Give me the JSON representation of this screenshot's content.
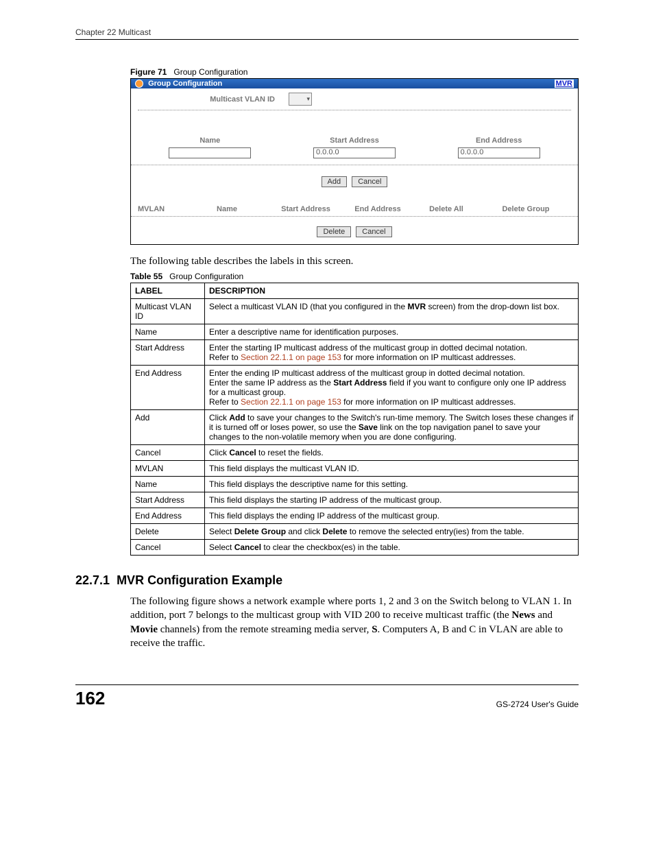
{
  "header": {
    "chapter": "Chapter 22 Multicast"
  },
  "figure": {
    "caption_label": "Figure 71",
    "caption_text": "Group Configuration",
    "title": "Group Configuration",
    "mvr_link": "MVR",
    "multicast_vlan_id_label": "Multicast VLAN ID",
    "cols": {
      "name": "Name",
      "start": "Start Address",
      "end": "End Address"
    },
    "inputs": {
      "name": "",
      "start": "0.0.0.0",
      "end": "0.0.0.0"
    },
    "add_btn": "Add",
    "cancel_btn": "Cancel",
    "table_head": {
      "mvlan": "MVLAN",
      "name": "Name",
      "start": "Start Address",
      "end": "End Address",
      "delete_all": "Delete All",
      "delete_group": "Delete Group"
    },
    "delete_btn": "Delete",
    "cancel2_btn": "Cancel"
  },
  "intro_text": "The following table describes the labels in this screen.",
  "table": {
    "caption_label": "Table 55",
    "caption_text": "Group Configuration",
    "head": {
      "label": "LABEL",
      "description": "DESCRIPTION"
    },
    "rows": [
      {
        "label": "Multicast VLAN ID",
        "desc_pre": "Select a multicast VLAN ID (that you configured in the ",
        "desc_bold": "MVR",
        "desc_post": " screen) from the drop-down list box."
      },
      {
        "label": "Name",
        "desc": "Enter a descriptive name for identification purposes."
      },
      {
        "label": "Start Address",
        "desc_line1": "Enter the starting IP multicast address of the multicast group in dotted decimal notation.",
        "desc_refer": "Refer to ",
        "desc_xref": "Section 22.1.1 on page 153",
        "desc_after": " for more information on IP multicast addresses."
      },
      {
        "label": "End Address",
        "l1": "Enter the ending IP multicast address of the multicast group in dotted decimal notation.",
        "l2_pre": "Enter the same IP address as the ",
        "l2_bold": "Start Address",
        "l2_post": " field if you want to configure only one IP address for a multicast group.",
        "l3_refer": "Refer to ",
        "l3_xref": "Section 22.1.1 on page 153",
        "l3_after": " for more information on IP multicast addresses."
      },
      {
        "label": "Add",
        "pre": "Click ",
        "b1": "Add",
        "mid1": " to save your changes to the Switch's run-time memory. The Switch loses these changes if it is turned off or loses power, so use the ",
        "b2": "Save",
        "post": " link on the top navigation panel to save your changes to the non-volatile memory when you are done configuring."
      },
      {
        "label": "Cancel",
        "pre": "Click ",
        "b1": "Cancel",
        "post": " to reset the fields."
      },
      {
        "label": "MVLAN",
        "desc": "This field displays the multicast VLAN ID."
      },
      {
        "label": "Name",
        "desc": "This field displays the descriptive name for this setting."
      },
      {
        "label": "Start Address",
        "desc": "This field displays the starting IP address of the multicast group."
      },
      {
        "label": "End Address",
        "desc": "This field displays the ending IP address of the multicast group."
      },
      {
        "label": "Delete",
        "pre": "Select ",
        "b1": "Delete Group",
        "mid1": " and click ",
        "b2": "Delete",
        "post": " to remove the selected entry(ies) from the table."
      },
      {
        "label": "Cancel",
        "pre": "Select ",
        "b1": "Cancel",
        "post": " to clear the checkbox(es) in the table."
      }
    ]
  },
  "section": {
    "number": "22.7.1",
    "title": "MVR Configuration Example",
    "p_pre": "The following figure shows a network example where ports 1, 2 and 3 on the Switch belong to VLAN 1. In addition, port 7 belongs to the multicast group with VID 200 to receive multicast traffic (the ",
    "p_b1": "News",
    "p_mid": " and ",
    "p_b2": "Movie",
    "p_post1": " channels) from the remote streaming media server, ",
    "p_b3": "S",
    "p_post2": ". Computers A, B and C in VLAN are able to receive the traffic."
  },
  "footer": {
    "page": "162",
    "guide": "GS-2724 User's Guide"
  }
}
